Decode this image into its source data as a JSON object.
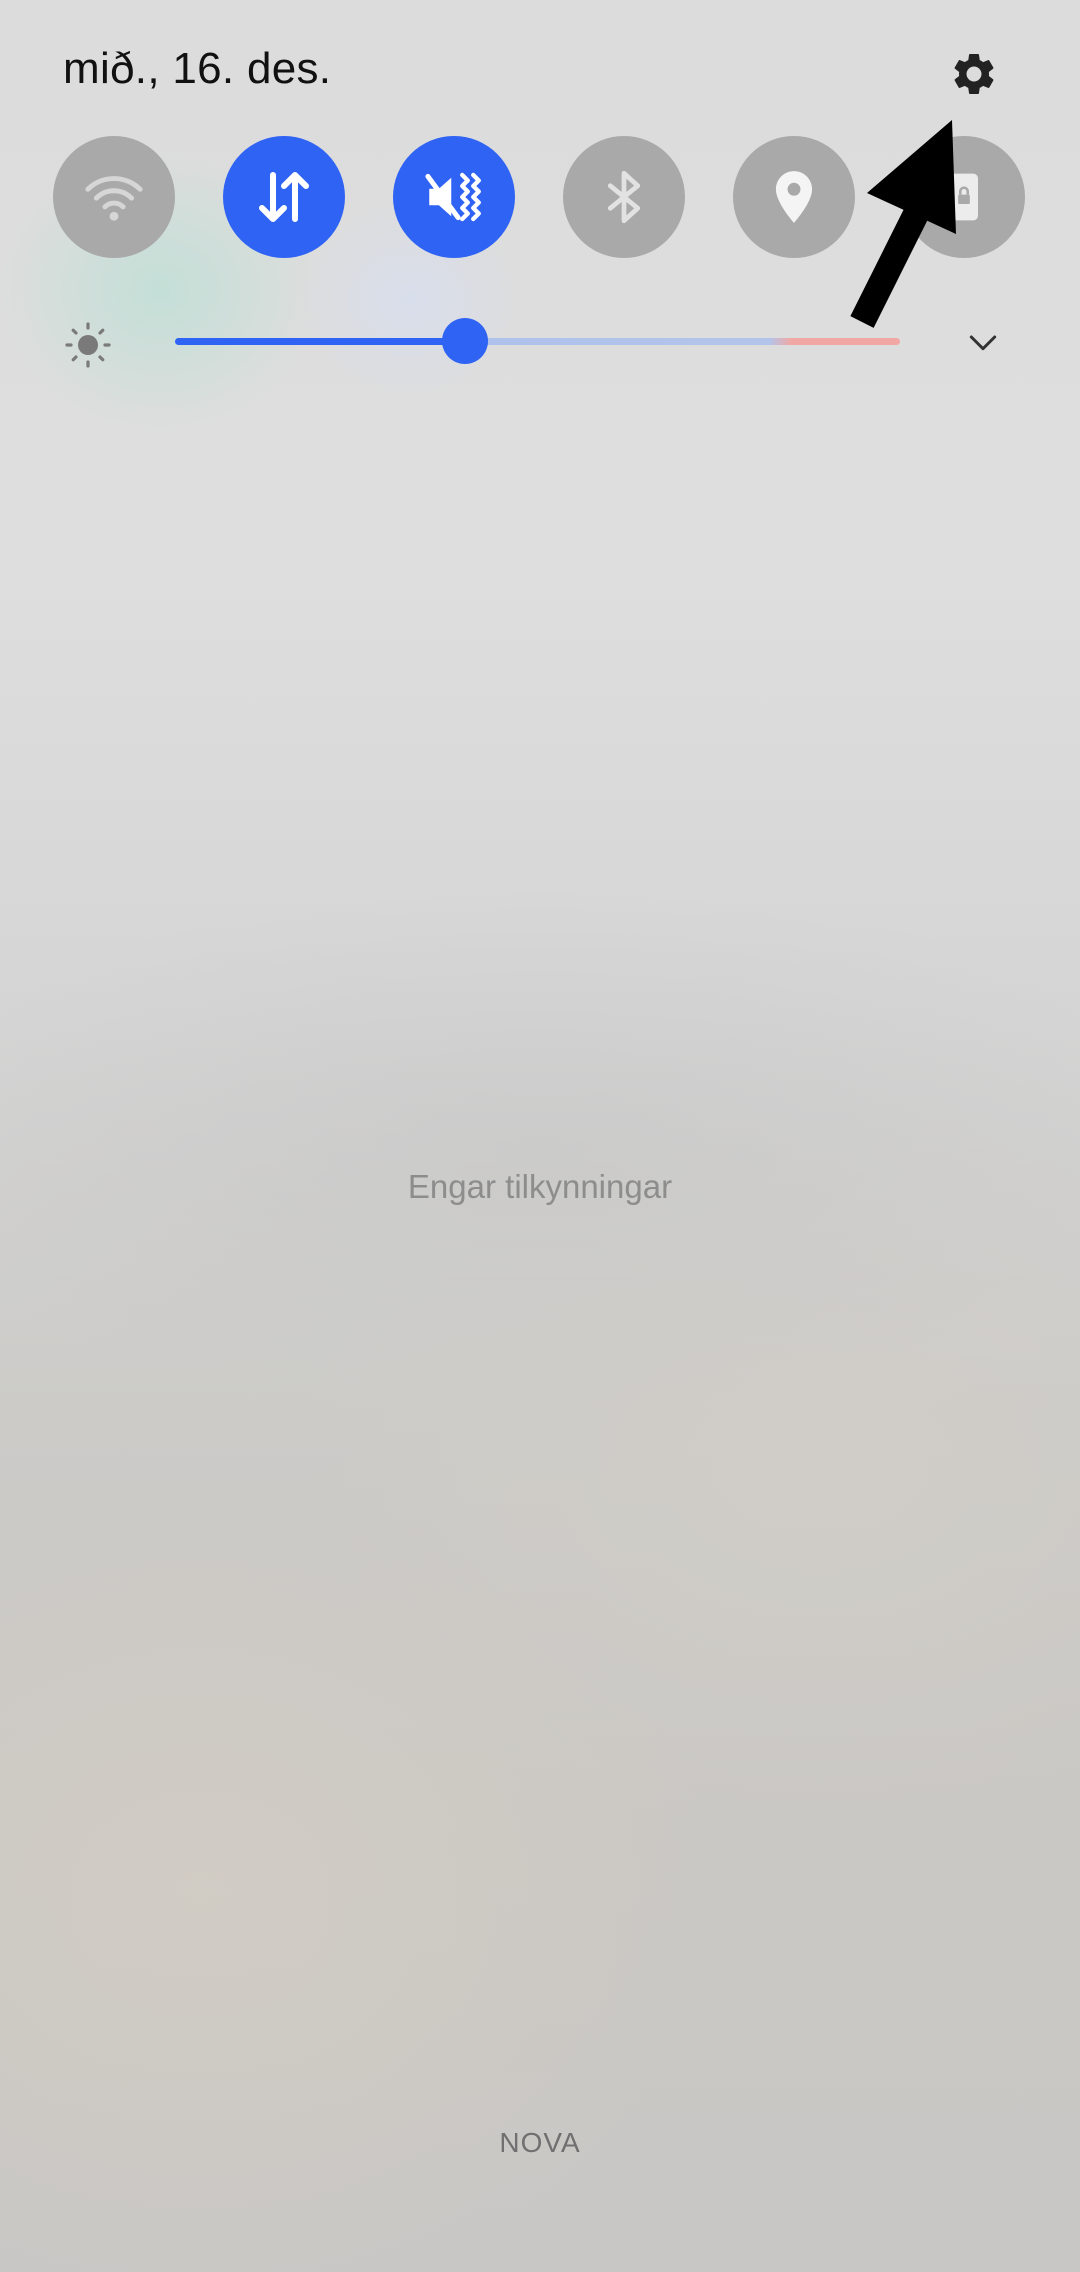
{
  "status": {
    "date": "mið., 16. des."
  },
  "quick_settings": {
    "tiles": [
      {
        "name": "wifi",
        "icon": "wifi-icon",
        "active": false
      },
      {
        "name": "mobile-data",
        "icon": "data-arrows-icon",
        "active": true
      },
      {
        "name": "sound-mode",
        "icon": "vibrate-icon",
        "active": true
      },
      {
        "name": "bluetooth",
        "icon": "bluetooth-icon",
        "active": false
      },
      {
        "name": "location",
        "icon": "location-pin-icon",
        "active": false
      },
      {
        "name": "screen-lock",
        "icon": "lock-icon",
        "active": false
      }
    ],
    "settings_icon": "gear-icon",
    "expand_icon": "chevron-down-icon"
  },
  "brightness": {
    "icon": "sun-icon",
    "level_fraction": 0.4
  },
  "notifications": {
    "empty_message": "Engar tilkynningar"
  },
  "footer": {
    "carrier": "NOVA"
  },
  "colors": {
    "accent": "#2f63f4",
    "tile_off": "#a9a9a9",
    "annotation_arrow": "#000000"
  }
}
